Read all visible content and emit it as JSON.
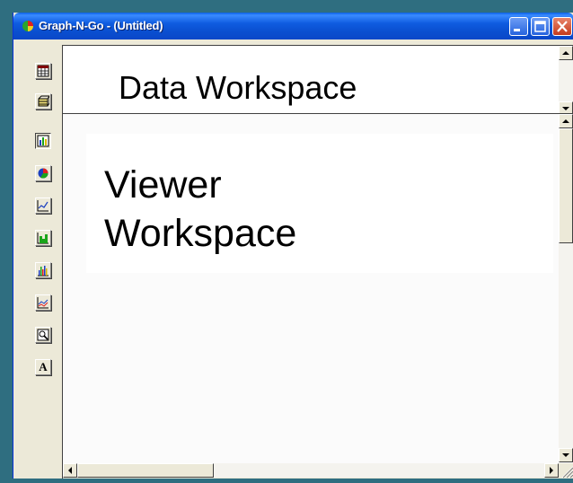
{
  "window": {
    "title": "Graph-N-Go - (Untitled)",
    "buttons": [
      "minimize",
      "maximize",
      "close"
    ],
    "caption_color": "#0a4fd0"
  },
  "toolbar": {
    "buttons": [
      {
        "icon": "spreadsheet-icon"
      },
      {
        "icon": "database-icon"
      },
      {
        "icon": "bar-chart-icon",
        "pressed": true
      },
      {
        "icon": "pie-chart-icon"
      },
      {
        "icon": "line-chart-icon"
      },
      {
        "icon": "histogram-icon"
      },
      {
        "icon": "multi-bar-chart-icon"
      },
      {
        "icon": "multi-line-chart-icon"
      },
      {
        "icon": "zoom-chart-icon"
      },
      {
        "icon": "text-icon",
        "label": "A"
      }
    ]
  },
  "data_workspace": {
    "label": "Data Workspace"
  },
  "viewer_workspace": {
    "label_line1": "Viewer",
    "label_line2": "Workspace"
  }
}
